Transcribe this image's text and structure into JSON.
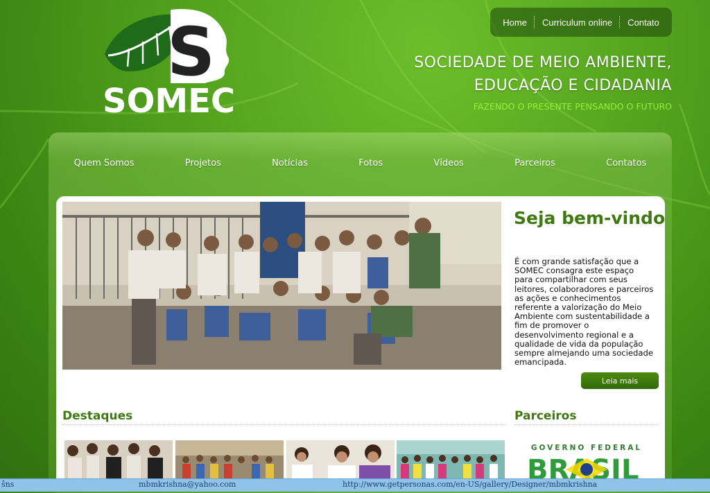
{
  "brand": {
    "name": "SOMEC",
    "logo_letter": "S"
  },
  "topnav": {
    "items": [
      "Home",
      "Curriculum online",
      "Contato"
    ]
  },
  "header": {
    "line1": "SOCIEDADE DE MEIO AMBIENTE,",
    "line2": "EDUCAÇÃO E CIDADANIA",
    "tagline": "FAZENDO O PRESENTE PENSANDO O FUTURO"
  },
  "mainnav": {
    "items": [
      "Quem Somos",
      "Projetos",
      "Notícias",
      "Fotos",
      "Vídeos",
      "Parceiros",
      "Contatos"
    ]
  },
  "welcome": {
    "title": "Seja bem-vindo",
    "lines": [
      "É com grande satisfação que a",
      "SOMEC consagra este espaço",
      "para compartilhar com seus",
      "leitores, colaboradores e parceiros",
      "as ações e conhecimentos",
      "referente a valorização do Meio",
      "Ambiente com sustentabilidade a",
      "fim de promover o",
      "desenvolvimento regional e a",
      "qualidade de vida da população",
      "sempre almejando uma sociedade",
      "emancipada."
    ],
    "button": "Leia mais"
  },
  "destaques": {
    "title": "Destaques"
  },
  "parceiros": {
    "title": "Parceiros",
    "logo_top": "GOVERNO FEDERAL",
    "logo_main": "BRASIL"
  },
  "statusbar": {
    "left": "ŝns",
    "email": "mbmkrishna@yahoo.com",
    "url": "http://www.getpersonas.com/en-US/gallery/Designer/mbmkrishna"
  },
  "colors": {
    "accent_green": "#3f7a10",
    "bright_green": "#98f03a",
    "status_blue": "#8fc3ea"
  }
}
